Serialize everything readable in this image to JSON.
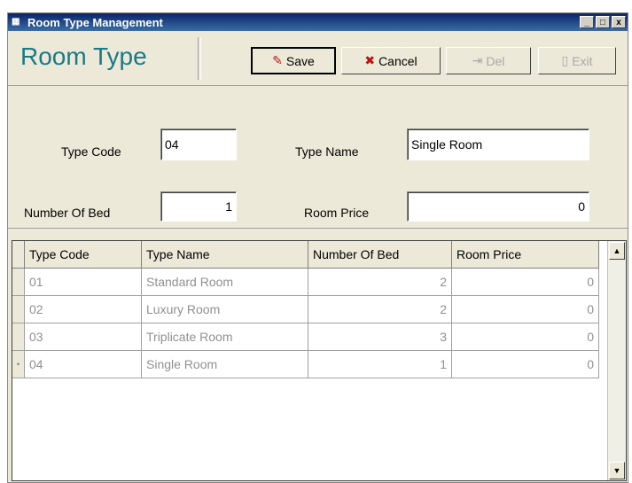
{
  "window": {
    "title": "Room Type Management",
    "minimize": "_",
    "maximize": "□",
    "close": "x"
  },
  "toolbar": {
    "heading": "Room Type",
    "save_label": "Save",
    "cancel_label": "Cancel",
    "del_label": "Del",
    "exit_label": "Exit"
  },
  "form": {
    "type_code_label": "Type Code",
    "type_code_value": "04",
    "type_name_label": "Type Name",
    "type_name_value": "Single Room",
    "beds_label": "Number Of Bed",
    "beds_value": "1",
    "price_label": "Room Price",
    "price_value": "0"
  },
  "table": {
    "headers": [
      "Type Code",
      "Type Name",
      "Number Of Bed",
      "Room Price"
    ],
    "rows": [
      [
        "01",
        "Standard Room",
        "2",
        "0"
      ],
      [
        "02",
        "Luxury Room",
        "2",
        "0"
      ],
      [
        "03",
        "Triplicate Room",
        "3",
        "0"
      ],
      [
        "04",
        "Single Room",
        "1",
        "0"
      ]
    ],
    "current_row_marker": "▪"
  },
  "scroll": {
    "up": "▲",
    "down": "▼"
  }
}
